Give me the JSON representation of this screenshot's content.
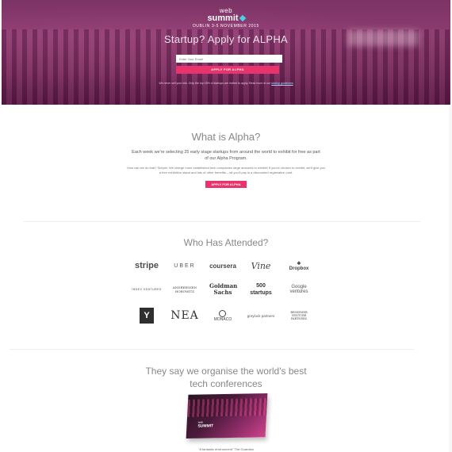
{
  "hero": {
    "brand_top": "web",
    "brand_bottom": "summit",
    "dates": "DUBLIN 3-5 NOVEMBER 2015",
    "title": "Startup? Apply for ALPHA",
    "email_placeholder": "Enter Your Email",
    "apply_label": "APPLY FOR ALPHA",
    "fine_print": "We never sell your info. Only the top 15% of startups are invited to apply. Read more at our",
    "fine_print_link": "startup guidelines"
  },
  "alpha": {
    "title": "What is Alpha?",
    "description": "Each week we're selecting 25 early stage startups from around the world to exhibit for free as part of our Alpha Program.",
    "subtext": "How can we do that? Simple: We charge more established tech companies large amounts to exhibit! If you're chosen to exhibit, we'll give you a free exhibition stand and lots of other benefits – all you'll pay is a discounted registration cost.",
    "apply_label": "APPLY FOR ALPHA"
  },
  "attended": {
    "title": "Who Has Attended?",
    "logos": [
      {
        "name": "stripe",
        "text": "stripe"
      },
      {
        "name": "uber",
        "text": "UBER"
      },
      {
        "name": "coursera",
        "text": "coursera"
      },
      {
        "name": "vine",
        "text": "Vine"
      },
      {
        "name": "dropbox",
        "text": "Dropbox"
      },
      {
        "name": "index-ventures",
        "text": "INDEX VENTURES"
      },
      {
        "name": "andreessen-horowitz",
        "text": "ANDREESSEN HOROWITZ"
      },
      {
        "name": "goldman-sachs",
        "text": "Goldman Sachs"
      },
      {
        "name": "500-startups",
        "text": "500 startups"
      },
      {
        "name": "google-ventures",
        "text": "Google ventures"
      },
      {
        "name": "y-combinator",
        "text": "Y"
      },
      {
        "name": "nea",
        "text": "NEA"
      },
      {
        "name": "monaco",
        "text": "MONACO"
      },
      {
        "name": "greylock-partners",
        "text": "greylock partners"
      },
      {
        "name": "bessemer",
        "text": "BESSEMER VENTURE PARTNERS"
      }
    ]
  },
  "conference": {
    "title_line1": "They say we organise the world's best",
    "title_line2": "tech conferences",
    "magazine_brand_top": "web",
    "magazine_brand_bottom": "SUMMIT",
    "quote": "\"A fantastic environment\" The Guardian"
  },
  "colors": {
    "accent": "#e8336c",
    "hero_tint": "#9a4479"
  }
}
